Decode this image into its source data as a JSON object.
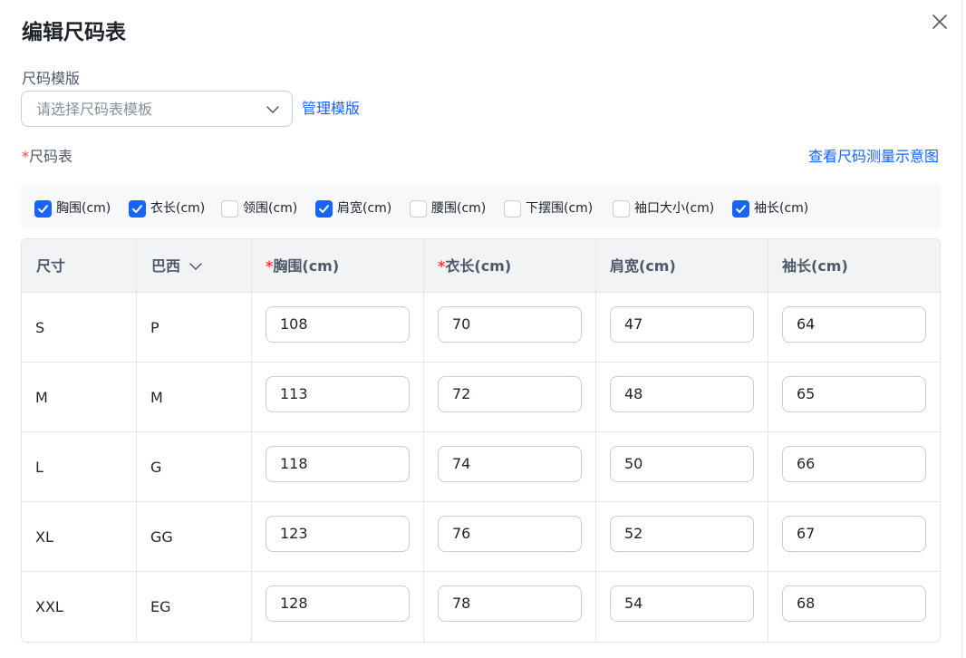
{
  "dialog": {
    "title": "编辑尺码表"
  },
  "template": {
    "label": "尺码模版",
    "placeholder": "请选择尺码表模板",
    "manage_label": "管理模版"
  },
  "size_table": {
    "required_mark": "*",
    "label": "尺码表",
    "view_diagram_label": "查看尺码测量示意图"
  },
  "measure_options": [
    {
      "label": "胸围(cm)",
      "checked": true
    },
    {
      "label": "衣长(cm)",
      "checked": true
    },
    {
      "label": "领围(cm)",
      "checked": false
    },
    {
      "label": "肩宽(cm)",
      "checked": true
    },
    {
      "label": "腰围(cm)",
      "checked": false
    },
    {
      "label": "下摆围(cm)",
      "checked": false
    },
    {
      "label": "袖口大小(cm)",
      "checked": false
    },
    {
      "label": "袖长(cm)",
      "checked": true
    }
  ],
  "table": {
    "headers": {
      "size": "尺寸",
      "region": "巴西",
      "chest_mark": "*",
      "chest": "胸围(cm)",
      "length_mark": "*",
      "length": "衣长(cm)",
      "shoulder": "肩宽(cm)",
      "sleeve": "袖长(cm)"
    },
    "rows": [
      {
        "size": "S",
        "region": "P",
        "chest": "108",
        "length": "70",
        "shoulder": "47",
        "sleeve": "64"
      },
      {
        "size": "M",
        "region": "M",
        "chest": "113",
        "length": "72",
        "shoulder": "48",
        "sleeve": "65"
      },
      {
        "size": "L",
        "region": "G",
        "chest": "118",
        "length": "74",
        "shoulder": "50",
        "sleeve": "66"
      },
      {
        "size": "XL",
        "region": "GG",
        "chest": "123",
        "length": "76",
        "shoulder": "52",
        "sleeve": "67"
      },
      {
        "size": "XXL",
        "region": "EG",
        "chest": "128",
        "length": "78",
        "shoulder": "54",
        "sleeve": "68"
      }
    ]
  },
  "icons": {
    "close": "close-icon",
    "dropdown": "chevron-down-icon",
    "check": "check-icon"
  },
  "colors": {
    "accent": "#1664ff",
    "required": "#f53f3f",
    "header_bg": "#f2f3f5"
  }
}
